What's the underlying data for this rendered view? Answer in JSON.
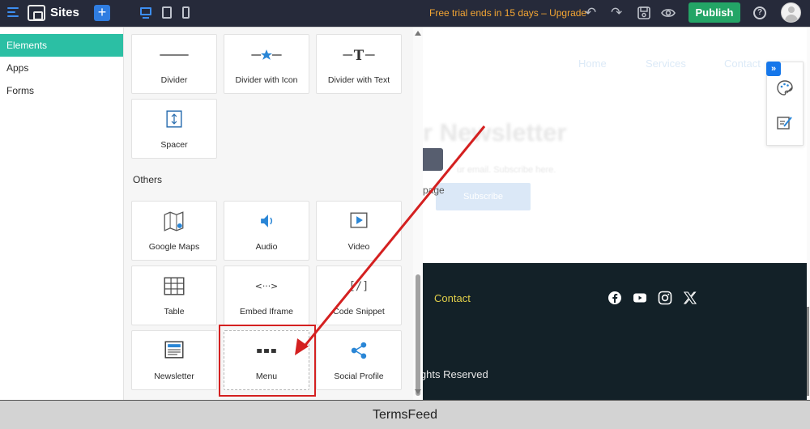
{
  "topbar": {
    "app_title": "Sites",
    "add_label": "+",
    "trial_notice": "Free trial ends in 15 days – Upgrade",
    "publish_label": "Publish",
    "help_label": "?"
  },
  "sidebar": {
    "items": [
      {
        "label": "Elements",
        "active": true
      },
      {
        "label": "Apps",
        "active": false
      },
      {
        "label": "Forms",
        "active": false
      }
    ]
  },
  "panel": {
    "tiles_top": [
      {
        "label": "Divider",
        "icon": "divider-icon"
      },
      {
        "label": "Divider with Icon",
        "icon": "divider-star-icon"
      },
      {
        "label": "Divider with Text",
        "icon": "divider-text-icon"
      },
      {
        "label": "Spacer",
        "icon": "spacer-icon"
      }
    ],
    "section_title": "Others",
    "tiles_others": [
      {
        "label": "Google Maps",
        "icon": "map-icon"
      },
      {
        "label": "Audio",
        "icon": "audio-icon"
      },
      {
        "label": "Video",
        "icon": "video-icon"
      },
      {
        "label": "Table",
        "icon": "table-icon"
      },
      {
        "label": "Embed Iframe",
        "icon": "embed-icon"
      },
      {
        "label": "Code Snippet",
        "icon": "code-icon"
      },
      {
        "label": "Newsletter",
        "icon": "newsletter-icon"
      },
      {
        "label": "Menu",
        "icon": "menu-dots-icon"
      },
      {
        "label": "Social Profile",
        "icon": "share-icon"
      }
    ],
    "divider_text_glyph": "T",
    "embed_glyph": "<···>",
    "code_glyph": "[/]"
  },
  "canvas": {
    "nav": [
      "Home",
      "Services",
      "Contact"
    ],
    "newsletter_title": "r Newsletter",
    "newsletter_sub": "ur email. Subscribe here.",
    "page_text": "page",
    "subscribe_label": "Subscribe",
    "footer_contact": "Contact",
    "copyright": "ights Reserved"
  },
  "footer": {
    "brand": "TermsFeed"
  },
  "colors": {
    "topbar_bg": "#262a3a",
    "accent_blue": "#2f7de1",
    "publish_green": "#23a566",
    "sidebar_active": "#2bbfa4",
    "trial_orange": "#f3a533",
    "footer_dark": "#132128",
    "annotation_red": "#d42020"
  }
}
